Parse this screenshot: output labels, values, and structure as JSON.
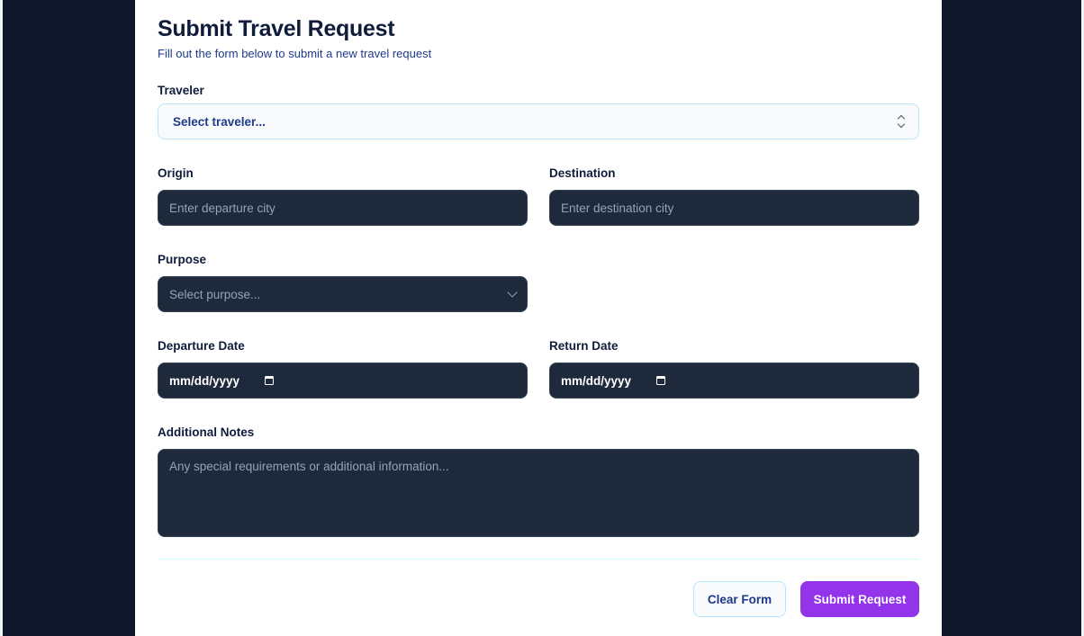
{
  "form": {
    "title": "Submit Travel Request",
    "subtitle": "Fill out the form below to submit a new travel request",
    "traveler": {
      "label": "Traveler",
      "value": "Select traveler..."
    },
    "origin": {
      "label": "Origin",
      "placeholder": "Enter departure city"
    },
    "destination": {
      "label": "Destination",
      "placeholder": "Enter destination city"
    },
    "purpose": {
      "label": "Purpose",
      "value": "Select purpose..."
    },
    "departure_date": {
      "label": "Departure Date",
      "value": "mm/dd/yyyy"
    },
    "return_date": {
      "label": "Return Date",
      "value": "mm/dd/yyyy"
    },
    "notes": {
      "label": "Additional Notes",
      "placeholder": "Any special requirements or additional information..."
    },
    "buttons": {
      "clear": "Clear Form",
      "submit": "Submit Request"
    }
  },
  "icons": {
    "traveler_select": "updown-chevron-icon",
    "purpose_select": "chevron-down-icon",
    "date_picker": "calendar-icon"
  },
  "colors": {
    "background": "#0f172a",
    "card": "#ffffff",
    "field": "#1e293b",
    "accent": "#9333ea",
    "heading": "#0f1c3a",
    "subtitle": "#1e3a8a"
  }
}
